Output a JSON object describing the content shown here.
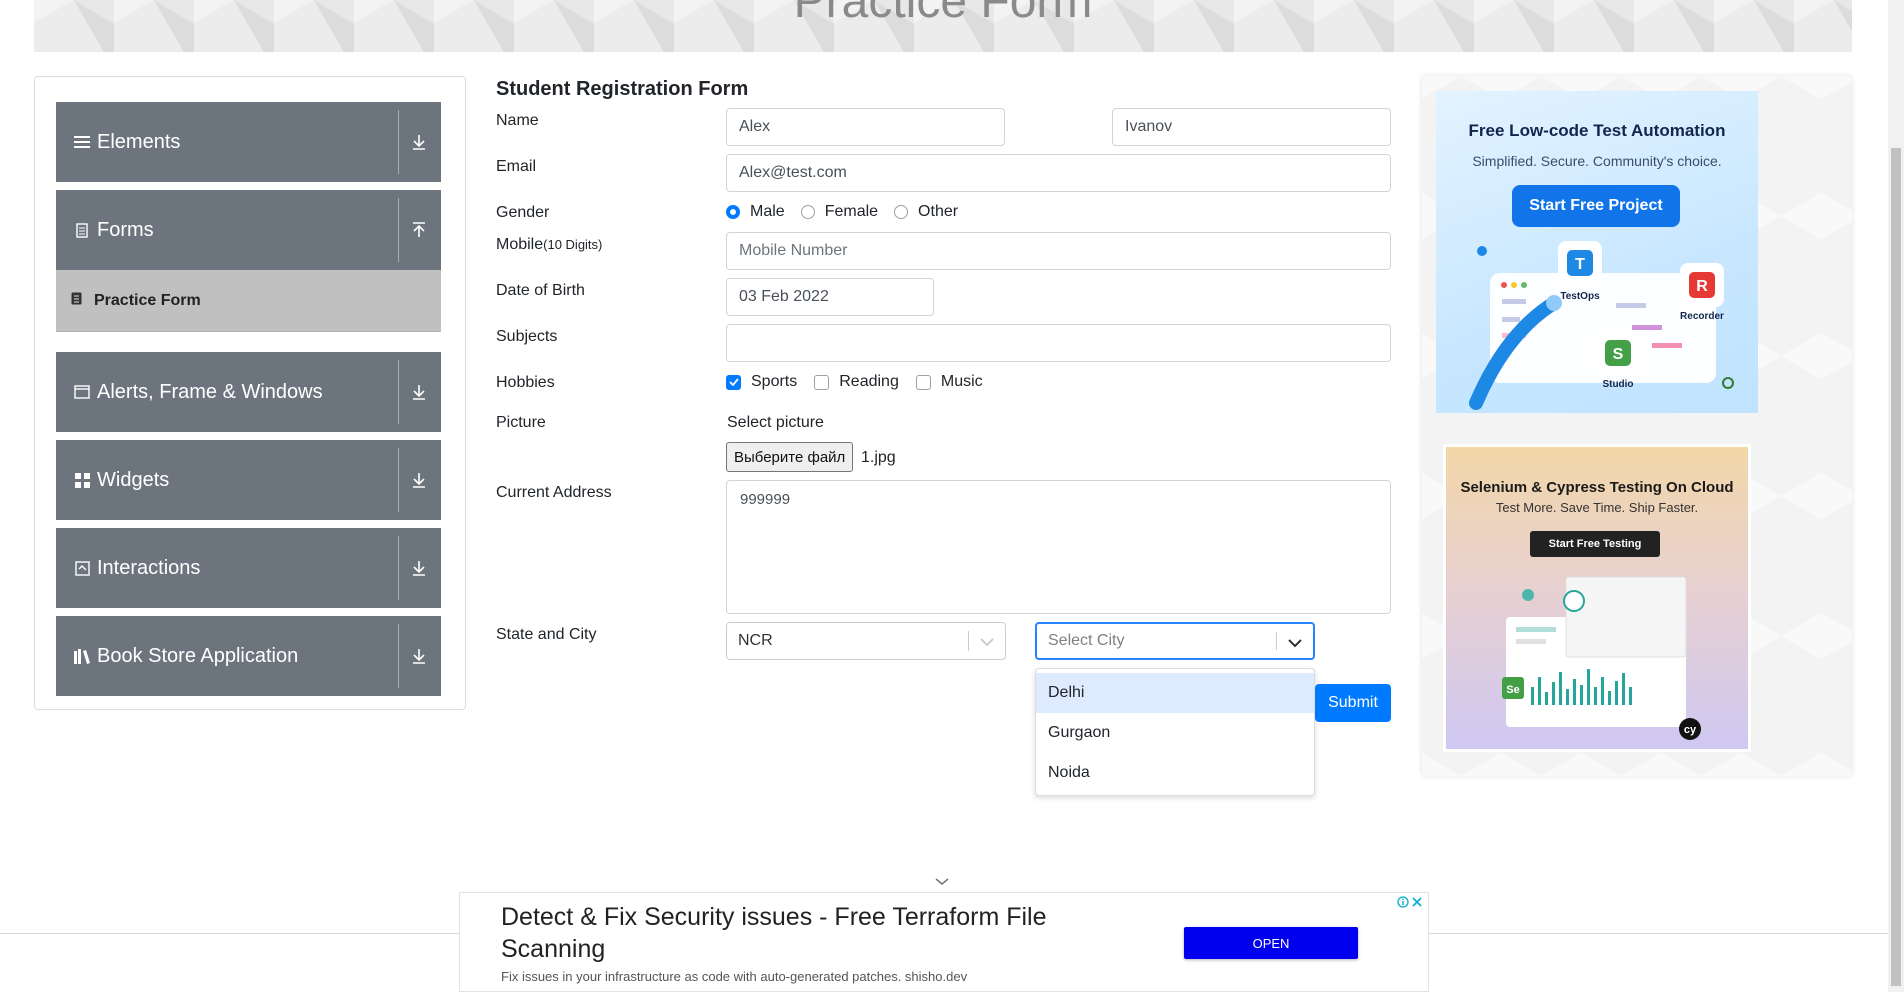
{
  "header": {
    "title": "Practice Form"
  },
  "sidebar": {
    "groups": [
      {
        "label": "Elements",
        "icon": "hamburger-icon"
      },
      {
        "label": "Forms",
        "icon": "document-icon"
      },
      {
        "label": "Alerts, Frame & Windows",
        "icon": "window-icon"
      },
      {
        "label": "Widgets",
        "icon": "widgets-icon"
      },
      {
        "label": "Interactions",
        "icon": "interactions-icon"
      },
      {
        "label": "Book Store Application",
        "icon": "books-icon"
      }
    ],
    "active_item": "Practice Form"
  },
  "form": {
    "title": "Student Registration Form",
    "name_label": "Name",
    "first_name": "Alex",
    "last_name": "Ivanov",
    "email_label": "Email",
    "email": "Alex@test.com",
    "gender_label": "Gender",
    "gender_options": [
      "Male",
      "Female",
      "Other"
    ],
    "gender_selected": "Male",
    "mobile_label": "Mobile",
    "mobile_hint": "(10 Digits)",
    "mobile_placeholder": "Mobile Number",
    "dob_label": "Date of Birth",
    "dob": "03 Feb 2022",
    "subjects_label": "Subjects",
    "hobbies_label": "Hobbies",
    "hobbies": [
      {
        "label": "Sports",
        "checked": true
      },
      {
        "label": "Reading",
        "checked": false
      },
      {
        "label": "Music",
        "checked": false
      }
    ],
    "picture_label": "Picture",
    "select_picture": "Select picture",
    "file_button": "Выберите файл",
    "file_name": "1.jpg",
    "address_label": "Current Address",
    "address": "999999",
    "state_city_label": "State and City",
    "state": "NCR",
    "city_placeholder": "Select City",
    "city_options": [
      "Delhi",
      "Gurgaon",
      "Noida"
    ],
    "submit": "Submit"
  },
  "ads": {
    "ad1": {
      "title": "Free Low-code Test Automation",
      "subtitle": "Simplified. Secure. Community's choice.",
      "button": "Start Free Project",
      "products": [
        "TestOps",
        "Recorder",
        "Studio"
      ]
    },
    "ad2": {
      "title": "Selenium & Cypress Testing On Cloud",
      "subtitle": "Test More. Save Time. Ship Faster.",
      "button": "Start Free Testing"
    },
    "bottom": {
      "title": "Detect & Fix Security issues - Free Terraform File Scanning",
      "description": "Fix issues in your infrastructure as code with auto-generated patches. shisho.dev",
      "button": "OPEN"
    }
  },
  "colors": {
    "accent": "#007bff",
    "sidebar": "#6c757d",
    "active_item": "#c0c0c0",
    "ad_button": "#0000ee"
  }
}
